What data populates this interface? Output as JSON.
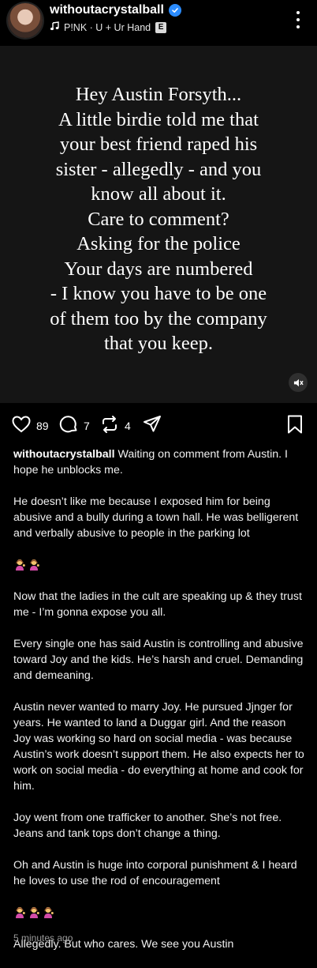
{
  "header": {
    "username": "withoutacrystalball",
    "song": "P!NK · U + Ur Hand",
    "explicit_badge": "E"
  },
  "media": {
    "text": "Hey Austin Forsyth...\nA little birdie told me that\nyour best friend raped his\nsister - allegedly - and you\nknow all about it.\nCare to comment?\nAsking for the police\nYour days are numbered\n- I know you have to be one\nof them too by the company\nthat you keep."
  },
  "actions": {
    "likes": "89",
    "comments": "7",
    "reposts": "4"
  },
  "caption": {
    "username": "withoutacrystalball",
    "intro": " Waiting on comment from Austin. I hope he unblocks me.",
    "paragraphs": [
      "He doesn’t like me because I exposed him for being abusive and a bully during a town hall. He was belligerent and verbally abusive to people in the parking lot",
      "Now that the ladies in the cult are speaking up & they trust me - I’m gonna expose you all.",
      "Every single one has said Austin is controlling and abusive toward Joy and the kids. He’s harsh and cruel. Demanding and demeaning.",
      "Austin never wanted to marry Joy. He pursued Jjnger for years. He wanted to land a Duggar girl. And the reason Joy was working so hard on social media - was because Austin’s work doesn’t support them. He also expects her to work on social media - do everything at home and cook for him.",
      "Joy went from one trafficker to another. She’s not free. Jeans and tank tops don’t change a thing.",
      "Oh and Austin is huge into corporal punishment & I heard he loves to use the rod of encouragement"
    ],
    "closing": "Allegedly. But who cares. We see you Austin"
  },
  "timestamp": "5 minutes ago",
  "icons": {
    "emoji": "woman-tipping-hand-emoji",
    "accent": "#2b8cff"
  }
}
